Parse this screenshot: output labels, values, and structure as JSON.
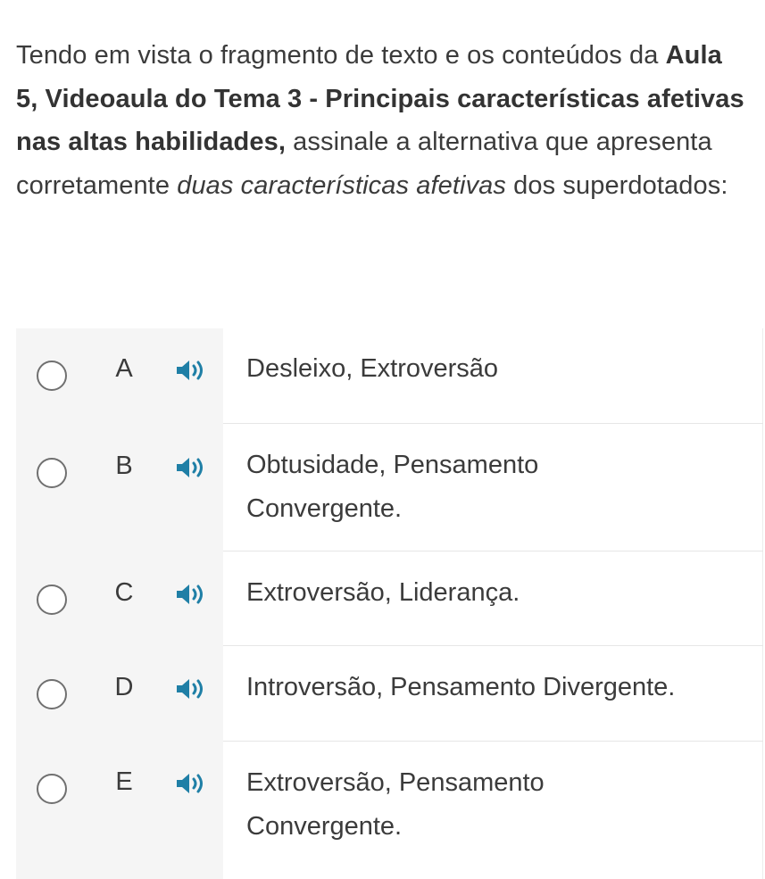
{
  "question": {
    "part1": "Tendo em vista o fragmento de texto e os conteúdos da ",
    "bold": "Aula 5, Videoaula do Tema 3 - Principais características afetivas nas altas habilidades,",
    "part2": " assinale a alternativa que apresenta corretamente ",
    "italic": "duas características afetivas",
    "part3": " dos superdotados:"
  },
  "options": [
    {
      "letter": "A",
      "text": "Desleixo, Extroversão"
    },
    {
      "letter": "B",
      "text": "Obtusidade, Pensamento Convergente."
    },
    {
      "letter": "C",
      "text": "Extroversão, Liderança."
    },
    {
      "letter": "D",
      "text": "Introversão, Pensamento Divergente."
    },
    {
      "letter": "E",
      "text": "Extroversão, Pensamento Convergente."
    }
  ],
  "icons": {
    "audio": "speaker-icon"
  },
  "colors": {
    "speaker": "#1f7fa6",
    "left_panel": "#f5f5f5",
    "text": "#3b3b3b"
  }
}
